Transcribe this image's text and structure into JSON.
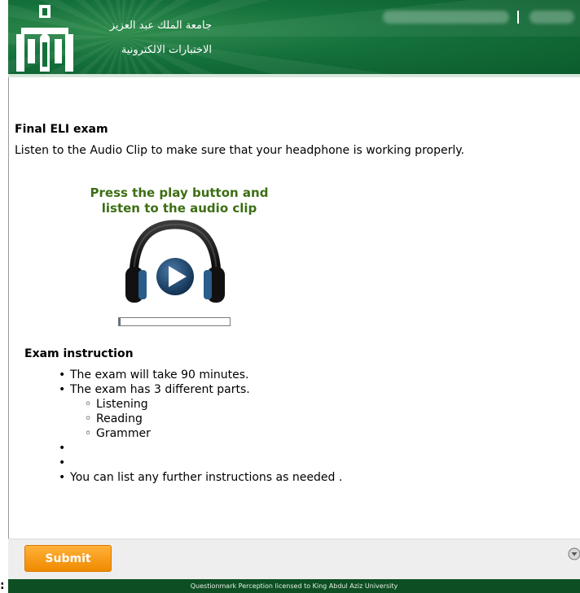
{
  "header": {
    "university_name": "جامعة الملك عبد العزيز",
    "system_name": "الاختبارات الالكترونية"
  },
  "exam": {
    "title": "Final ELI exam",
    "description": "Listen to the Audio Clip to make sure that your headphone is working properly."
  },
  "audio": {
    "prompt_line1": "Press the play button and",
    "prompt_line2": "listen to the audio clip",
    "progress": 0.01
  },
  "instructions": {
    "heading": "Exam instruction",
    "items": [
      "The exam will take 90 minutes.",
      "The exam has 3 different parts."
    ],
    "parts": [
      "Listening",
      "Reading",
      "Grammer"
    ],
    "empty_items": [
      "",
      ""
    ],
    "last_item": "You can list any further instructions as needed ."
  },
  "footer": {
    "submit_label": "Submit",
    "licence": "Questionmark Perception licensed to King Abdul Aziz University",
    "left_mark": ":"
  },
  "colors": {
    "header_green": "#14703a",
    "prompt_green": "#3c6e14",
    "submit_orange": "#f08a00",
    "licence_green": "#0d4f22"
  },
  "icons": {
    "logo": "kau-logo",
    "play": "headphone-play-icon",
    "help": "help-icon"
  }
}
